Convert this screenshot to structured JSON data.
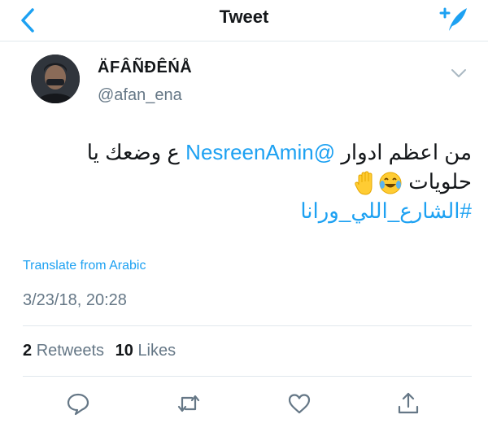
{
  "nav": {
    "title": "Tweet"
  },
  "author": {
    "name": "ÄFÂÑÐÊŃÅ",
    "handle": "@afan_ena"
  },
  "tweet": {
    "line1_text": "من اعظم ادوار ",
    "line1_mention": "@NesreenAmin",
    "line1_end": " ع وضعك يا",
    "line2_text": "حلويات ",
    "line3_hashtag": "#الشارع_اللي_ورانا"
  },
  "translate_label": "Translate from Arabic",
  "timestamp": "3/23/18, 20:28",
  "stats": {
    "retweets_count": "2",
    "retweets_label": "Retweets",
    "likes_count": "10",
    "likes_label": "Likes"
  },
  "colors": {
    "accent": "#1da1f2",
    "secondary_text": "#657786",
    "divider": "#e1e8ed"
  },
  "icons": [
    "back-chevron-icon",
    "compose-tweet-icon",
    "caret-down-icon",
    "reply-icon",
    "retweet-icon",
    "like-icon",
    "share-icon"
  ]
}
